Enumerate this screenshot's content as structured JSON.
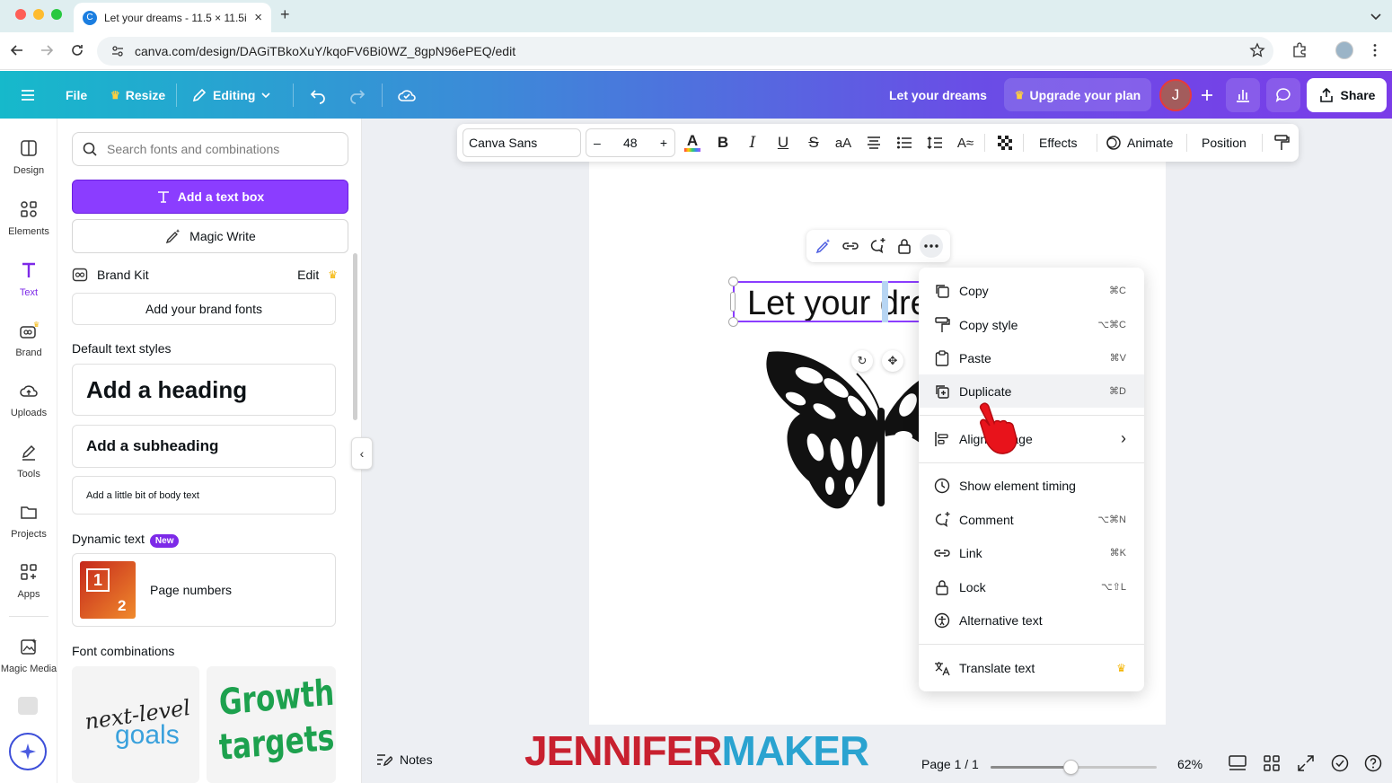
{
  "browser": {
    "tab_title": "Let your dreams - 11.5 × 11.5i",
    "tab_close": "×",
    "new_tab": "+",
    "url": "canva.com/design/DAGiTBkoXuY/kqoFV6Bi0WZ_8gpN96ePEQ/edit"
  },
  "topbar": {
    "file": "File",
    "resize": "Resize",
    "editing": "Editing",
    "design_title": "Let your dreams",
    "upgrade": "Upgrade your plan",
    "avatar_initial": "J",
    "share": "Share",
    "accent_gradient": [
      "#16b9cb",
      "#7a3ce8"
    ]
  },
  "rail": {
    "items": [
      {
        "label": "Design",
        "icon": "design-icon"
      },
      {
        "label": "Elements",
        "icon": "elements-icon"
      },
      {
        "label": "Text",
        "icon": "text-icon"
      },
      {
        "label": "Brand",
        "icon": "brand-icon"
      },
      {
        "label": "Uploads",
        "icon": "uploads-icon"
      },
      {
        "label": "Tools",
        "icon": "tools-icon"
      },
      {
        "label": "Projects",
        "icon": "projects-icon"
      },
      {
        "label": "Apps",
        "icon": "apps-icon"
      },
      {
        "label": "Magic Media",
        "icon": "magic-media-icon"
      }
    ],
    "active": "Text",
    "active_color": "#7d2ae8"
  },
  "panel": {
    "search_placeholder": "Search fonts and combinations",
    "add_text_box": "Add a text box",
    "magic_write": "Magic Write",
    "brand_kit": "Brand Kit",
    "brand_kit_edit": "Edit",
    "add_brand_fonts": "Add your brand fonts",
    "default_styles_title": "Default text styles",
    "heading": "Add a heading",
    "subheading": "Add a subheading",
    "body": "Add a little bit of body text",
    "dynamic_title": "Dynamic text",
    "new_badge": "New",
    "page_numbers": "Page numbers",
    "page_numbers_thumb": [
      "1",
      "2"
    ],
    "font_combinations_title": "Font combinations",
    "combo1": [
      "next-level",
      "goals"
    ],
    "combo2": [
      "Growth",
      "targets"
    ]
  },
  "toolbar": {
    "font": "Canva Sans",
    "size_minus": "–",
    "font_size": "48",
    "size_plus": "+",
    "text_color": "A",
    "bold": "B",
    "italic": "I",
    "underline": "U",
    "strike": "S",
    "case": "aA",
    "effects": "Effects",
    "animate": "Animate",
    "position": "Position"
  },
  "canvas": {
    "text": "Let your dreams"
  },
  "context_menu": {
    "items": [
      {
        "label": "Copy",
        "shortcut": "⌘C",
        "icon": "copy-icon"
      },
      {
        "label": "Copy style",
        "shortcut": "⌥⌘C",
        "icon": "paint-roller-icon"
      },
      {
        "label": "Paste",
        "shortcut": "⌘V",
        "icon": "clipboard-icon"
      },
      {
        "label": "Duplicate",
        "shortcut": "⌘D",
        "icon": "duplicate-icon"
      },
      {
        "label": "Align to page",
        "shortcut": "›",
        "icon": "align-icon"
      },
      {
        "label": "Show element timing",
        "shortcut": "",
        "icon": "clock-icon"
      },
      {
        "label": "Comment",
        "shortcut": "⌥⌘N",
        "icon": "comment-icon"
      },
      {
        "label": "Link",
        "shortcut": "⌘K",
        "icon": "link-icon"
      },
      {
        "label": "Lock",
        "shortcut": "⌥⇧L",
        "icon": "lock-icon"
      },
      {
        "label": "Alternative text",
        "shortcut": "",
        "icon": "accessibility-icon"
      },
      {
        "label": "Translate text",
        "shortcut": "♛",
        "icon": "translate-icon"
      }
    ],
    "highlighted": "Duplicate"
  },
  "bottombar": {
    "notes": "Notes",
    "page_counter": "Page 1 / 1",
    "zoom": "62%",
    "zoom_fraction": 0.48
  },
  "watermark": {
    "part1": "JENNIFER",
    "part2": "MAKER",
    "color1": "#c8202f",
    "color2": "#2aa3d0"
  }
}
